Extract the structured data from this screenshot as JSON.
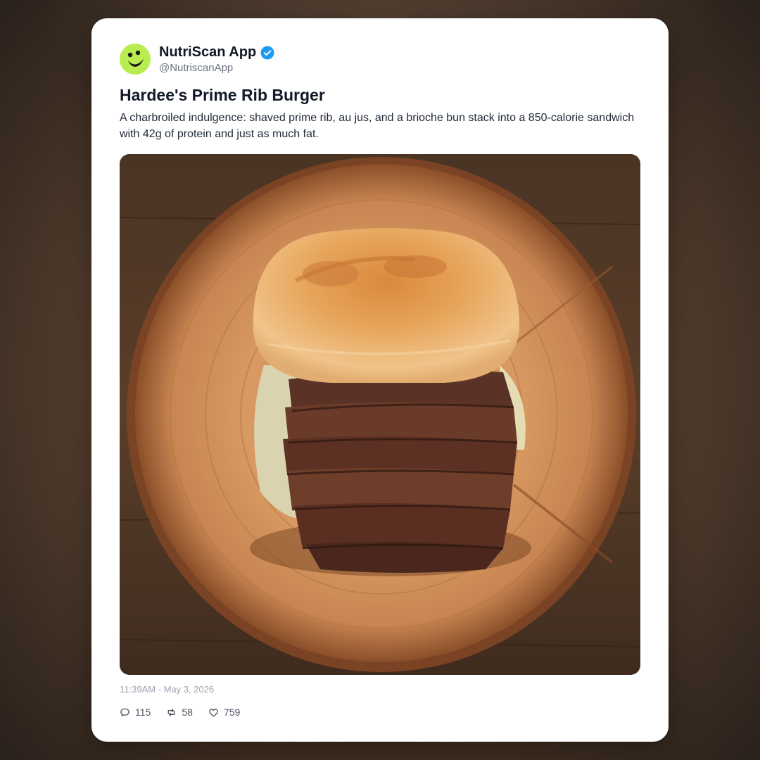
{
  "post": {
    "author_name": "NutriScan App",
    "handle": "@NutriscanApp",
    "title": "Hardee's Prime Rib Burger",
    "description": "A charbroiled indulgence: shaved prime rib, au jus, and a brioche bun stack into a 850-calorie sandwich with 42g of protein and just as much fat.",
    "timestamp": "11:39AM - May 3, 2026",
    "stats": {
      "replies": "115",
      "reposts": "58",
      "likes": "759"
    }
  },
  "colors": {
    "avatar_bg": "#b9ec4e",
    "verified": "#1d9bf0"
  },
  "icons": {
    "avatar": "face-logo-icon",
    "verified": "verified-badge-icon",
    "reply": "comment-icon",
    "repost": "repost-icon",
    "like": "heart-icon"
  }
}
